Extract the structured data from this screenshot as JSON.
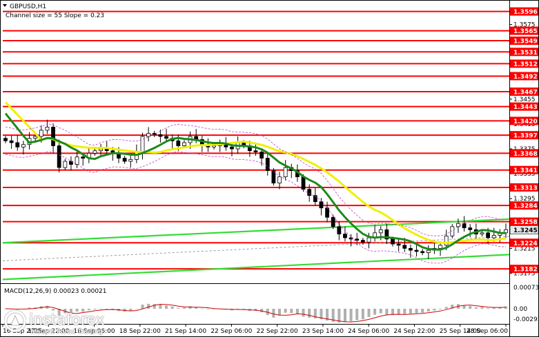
{
  "header": {
    "symbol": "GBPUSD,H1",
    "indicator_note": "Channel size = 55 Slope = 0.23"
  },
  "macd_label": "MACD(12,26,9) 0.00023 0.00021",
  "logo": {
    "brand": "instaforex",
    "tagline": "Instant Forex Trading"
  },
  "colors": {
    "level": "#ff0000",
    "tag_bg": "#ff0000",
    "ma_green": "#1b8a1b",
    "ma_yellow": "#f0f000",
    "channel": "#33dd33",
    "candles": "#000000",
    "bands": "#c040c0",
    "macd_hist": "#b0b0b0",
    "macd_signal": "#cc0000",
    "current_tag_bg": "#e8e8e8"
  },
  "chart_data": {
    "type": "candlestick",
    "title": "GBPUSD,H1",
    "ylim": [
      1.316,
      1.361
    ],
    "price_ticks": [
      "1.3575",
      "1.3455",
      "1.3415",
      "1.3375",
      "1.3335",
      "1.3295",
      "1.3215",
      "1.3175"
    ],
    "levels": [
      "1.3596",
      "1.3565",
      "1.3549",
      "1.3531",
      "1.3512",
      "1.3492",
      "1.3467",
      "1.3443",
      "1.3420",
      "1.3397",
      "1.3368",
      "1.3341",
      "1.3313",
      "1.3284",
      "1.3258",
      "1.3224",
      "1.3182"
    ],
    "current_price": "1.3245",
    "time_labels": [
      "16 Sep 2025",
      "17 Sep 22:00",
      "18 Sep 06:00",
      "18 Sep 22:00",
      "21 Sep 14:00",
      "22 Sep 06:00",
      "22 Sep 22:00",
      "23 Sep 14:00",
      "24 Sep 06:00",
      "24 Sep 22:00",
      "25 Sep 14:00",
      "28 Sep 06:00"
    ],
    "closes": [
      1.3388,
      1.3385,
      1.3378,
      1.3382,
      1.3392,
      1.3395,
      1.3405,
      1.341,
      1.338,
      1.3345,
      1.3355,
      1.335,
      1.3362,
      1.336,
      1.3368,
      1.3372,
      1.3375,
      1.3372,
      1.3368,
      1.336,
      1.3355,
      1.3358,
      1.337,
      1.3395,
      1.34,
      1.3398,
      1.3395,
      1.3392,
      1.3388,
      1.338,
      1.3385,
      1.3395,
      1.339,
      1.3382,
      1.3378,
      1.338,
      1.3382,
      1.3378,
      1.3375,
      1.3385,
      1.338,
      1.3372,
      1.337,
      1.336,
      1.334,
      1.332,
      1.333,
      1.3345,
      1.334,
      1.333,
      1.331,
      1.33,
      1.329,
      1.328,
      1.3265,
      1.325,
      1.3238,
      1.3232,
      1.323,
      1.3228,
      1.3225,
      1.3232,
      1.324,
      1.3245,
      1.323,
      1.3222,
      1.322,
      1.3215,
      1.3212,
      1.321,
      1.3208,
      1.3212,
      1.3215,
      1.322,
      1.3235,
      1.325,
      1.3255,
      1.3248,
      1.3245,
      1.3238,
      1.324,
      1.3232,
      1.3236,
      1.324,
      1.3245
    ],
    "macd": {
      "name": "MACD(12,26,9)",
      "main": "0.00023",
      "signal": "0.00021",
      "axis_top": "0.00073",
      "axis_zero": "0.00",
      "axis_bottom": "-0.00293"
    }
  }
}
